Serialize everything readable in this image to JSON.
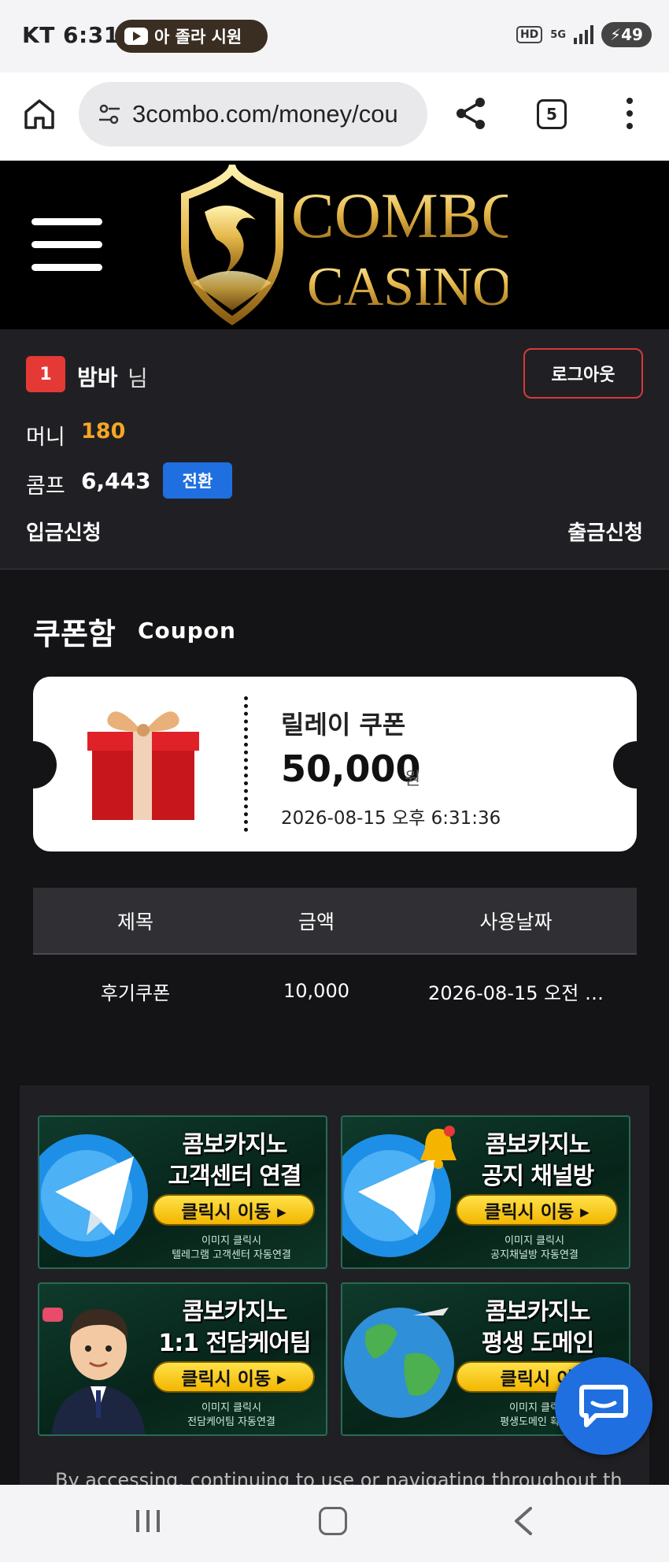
{
  "status_bar": {
    "carrier_time": "KT 6:31",
    "media_pill": "아 졸라 시원",
    "network_hd": "HD",
    "network_5g": "5G",
    "battery": "49"
  },
  "browser": {
    "url": "3combo.com/money/cou",
    "tab_count": "5"
  },
  "site": {
    "logo_line1": "COMBO",
    "logo_line2": "CASINO"
  },
  "user": {
    "level": "1",
    "name": "밤바",
    "name_suffix": "님",
    "logout_label": "로그아웃",
    "money_label": "머니",
    "money_value": "180",
    "comp_label": "콤프",
    "comp_value": "6,443",
    "convert_label": "전환",
    "deposit_label": "입금신청",
    "withdraw_label": "출금신청"
  },
  "coupon": {
    "title": "쿠폰함",
    "subtitle": "Coupon",
    "ticket": {
      "name": "릴레이 쿠폰",
      "amount": "50,000",
      "unit": "원",
      "date": "2026-08-15 오후 6:31:36"
    },
    "table": {
      "headers": [
        "제목",
        "금액",
        "사용날짜"
      ],
      "rows": [
        [
          "후기쿠폰",
          "10,000",
          "2026-08-15 오전 …"
        ]
      ]
    }
  },
  "banners": [
    {
      "line1": "콤보카지노",
      "line2": "고객센터 연결",
      "button": "클릭시 이동 ▸",
      "sub1": "이미지 클릭시",
      "sub2": "텔레그램 고객센터 자동연결"
    },
    {
      "line1": "콤보카지노",
      "line2": "공지 채널방",
      "button": "클릭시 이동 ▸",
      "sub1": "이미지 클릭시",
      "sub2": "공지채널방 자동연결"
    },
    {
      "line1": "콤보카지노",
      "line2": "1:1 전담케어팀",
      "button": "클릭시 이동 ▸",
      "sub1": "이미지 클릭시",
      "sub2": "전담케어팀 자동연결"
    },
    {
      "line1": "콤보카지노",
      "line2": "평생 도메인",
      "button": "클릭시 이",
      "sub1": "이미지 클릭",
      "sub2": "평생도메인 확시"
    }
  ],
  "footer_text": "By accessing, continuing to use or navigating throughout this",
  "colors": {
    "accent_gold": "#f5a623",
    "button_blue": "#1f6fe0",
    "level_red": "#e53935",
    "page_bg": "#141416"
  },
  "icons": {
    "home": "home-icon",
    "share": "share-icon",
    "more": "more-vert-icon",
    "chat": "chat-icon",
    "gift": "gift-icon"
  }
}
